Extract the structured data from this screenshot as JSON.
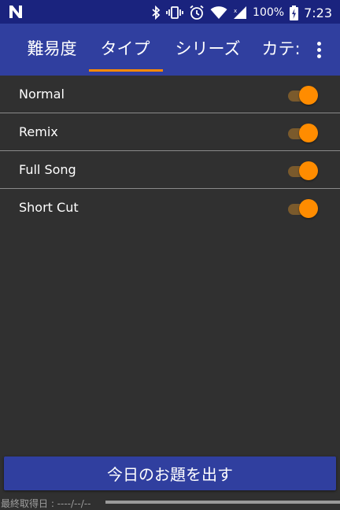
{
  "status_bar": {
    "battery_percent": "100%",
    "time": "7:23",
    "left_icon": "n-notification-icon",
    "icons": [
      "bluetooth-icon",
      "vibrate-icon",
      "alarm-icon",
      "wifi-icon",
      "cell-signal-icon",
      "battery-charging-icon"
    ]
  },
  "tabs": {
    "items": [
      {
        "label": "難易度"
      },
      {
        "label": "タイプ"
      },
      {
        "label": "シリーズ"
      },
      {
        "label": "カテ:"
      }
    ],
    "selected_index": 1,
    "overflow_icon": "more-vert-icon"
  },
  "list": {
    "items": [
      {
        "label": "Normal",
        "enabled": true
      },
      {
        "label": "Remix",
        "enabled": true
      },
      {
        "label": "Full Song",
        "enabled": true
      },
      {
        "label": "Short Cut",
        "enabled": true
      }
    ]
  },
  "action": {
    "button_label": "今日のお題を出す"
  },
  "footer": {
    "last_fetched": "最終取得日 : ----/--/--",
    "progress": 0
  },
  "colors": {
    "status_bar": "#1a237e",
    "primary": "#303f9f",
    "accent": "#ff8c00",
    "background": "#303030"
  }
}
